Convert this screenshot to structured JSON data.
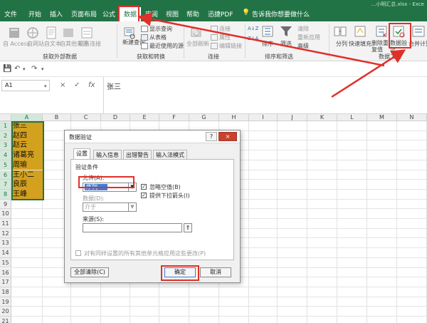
{
  "window": {
    "title_fragment": "…小明汇总.xlsx - Exce"
  },
  "tabs": [
    "开始",
    "插入",
    "页面布局",
    "公式",
    "数据",
    "审阅",
    "视图",
    "帮助",
    "迅捷PDF"
  ],
  "active_tab": "数据",
  "tell_me": "告诉我你想要做什么",
  "ribbon": {
    "external": [
      "自 Access",
      "自网站",
      "自文本",
      "自其他来源",
      "现有连接"
    ],
    "new_query": "新建查询",
    "query_small": [
      "显示查询",
      "从表格",
      "最近使用的源"
    ],
    "refresh_all": "全部刷新",
    "conn_small": [
      "连接",
      "属性",
      "编辑链接"
    ],
    "sort_az": "A↓Z",
    "sort_za": "Z↓A",
    "sort": "排序",
    "filter": "筛选",
    "filter_small": [
      "清除",
      "重新应用",
      "高级"
    ],
    "split": "分列",
    "flash_fill": "快速填充",
    "remove_dup": "删除重复值",
    "validation": "数据验证",
    "consolidate": "合并计算",
    "groups": [
      "获取外部数据",
      "获取和转换",
      "连接",
      "排序和筛选",
      "数据工具"
    ]
  },
  "formula_bar": {
    "name_box": "A1",
    "fx": "fx",
    "cancel": "×",
    "enter": "✓",
    "value": "张三"
  },
  "columns": [
    "A",
    "B",
    "C",
    "D",
    "E",
    "F",
    "G",
    "H",
    "I",
    "J",
    "K",
    "L",
    "M",
    "N"
  ],
  "rows": [
    "1",
    "2",
    "3",
    "4",
    "5",
    "6",
    "7",
    "8",
    "9",
    "10",
    "11",
    "12",
    "13",
    "14",
    "15",
    "16",
    "17",
    "18",
    "19",
    "20",
    "21"
  ],
  "cells": [
    "张三",
    "赵四",
    "赵云",
    "诸葛亮",
    "周瑜",
    "王小二",
    "良辰",
    "王峰"
  ],
  "dialog": {
    "title": "数据验证",
    "help": "?",
    "close": "×",
    "tabs": [
      "设置",
      "输入信息",
      "出错警告",
      "输入法模式"
    ],
    "criteria": "验证条件",
    "allow_label": "允许(A):",
    "allow_value": "序列",
    "ignore_blank": "忽略空值(B)",
    "dropdown": "提供下拉箭头(I)",
    "data_label": "数据(D):",
    "data_value": "介于",
    "source_label": "来源(S):",
    "apply_all": "对有同样设置的所有其他单元格应用这些更改(P)",
    "clear_all": "全部清除(C)",
    "ok": "确定",
    "cancel": "取消"
  },
  "colors": {
    "excel_green": "#217346",
    "cell_fill": "#d4a11e",
    "highlight_red": "#e0302a"
  }
}
